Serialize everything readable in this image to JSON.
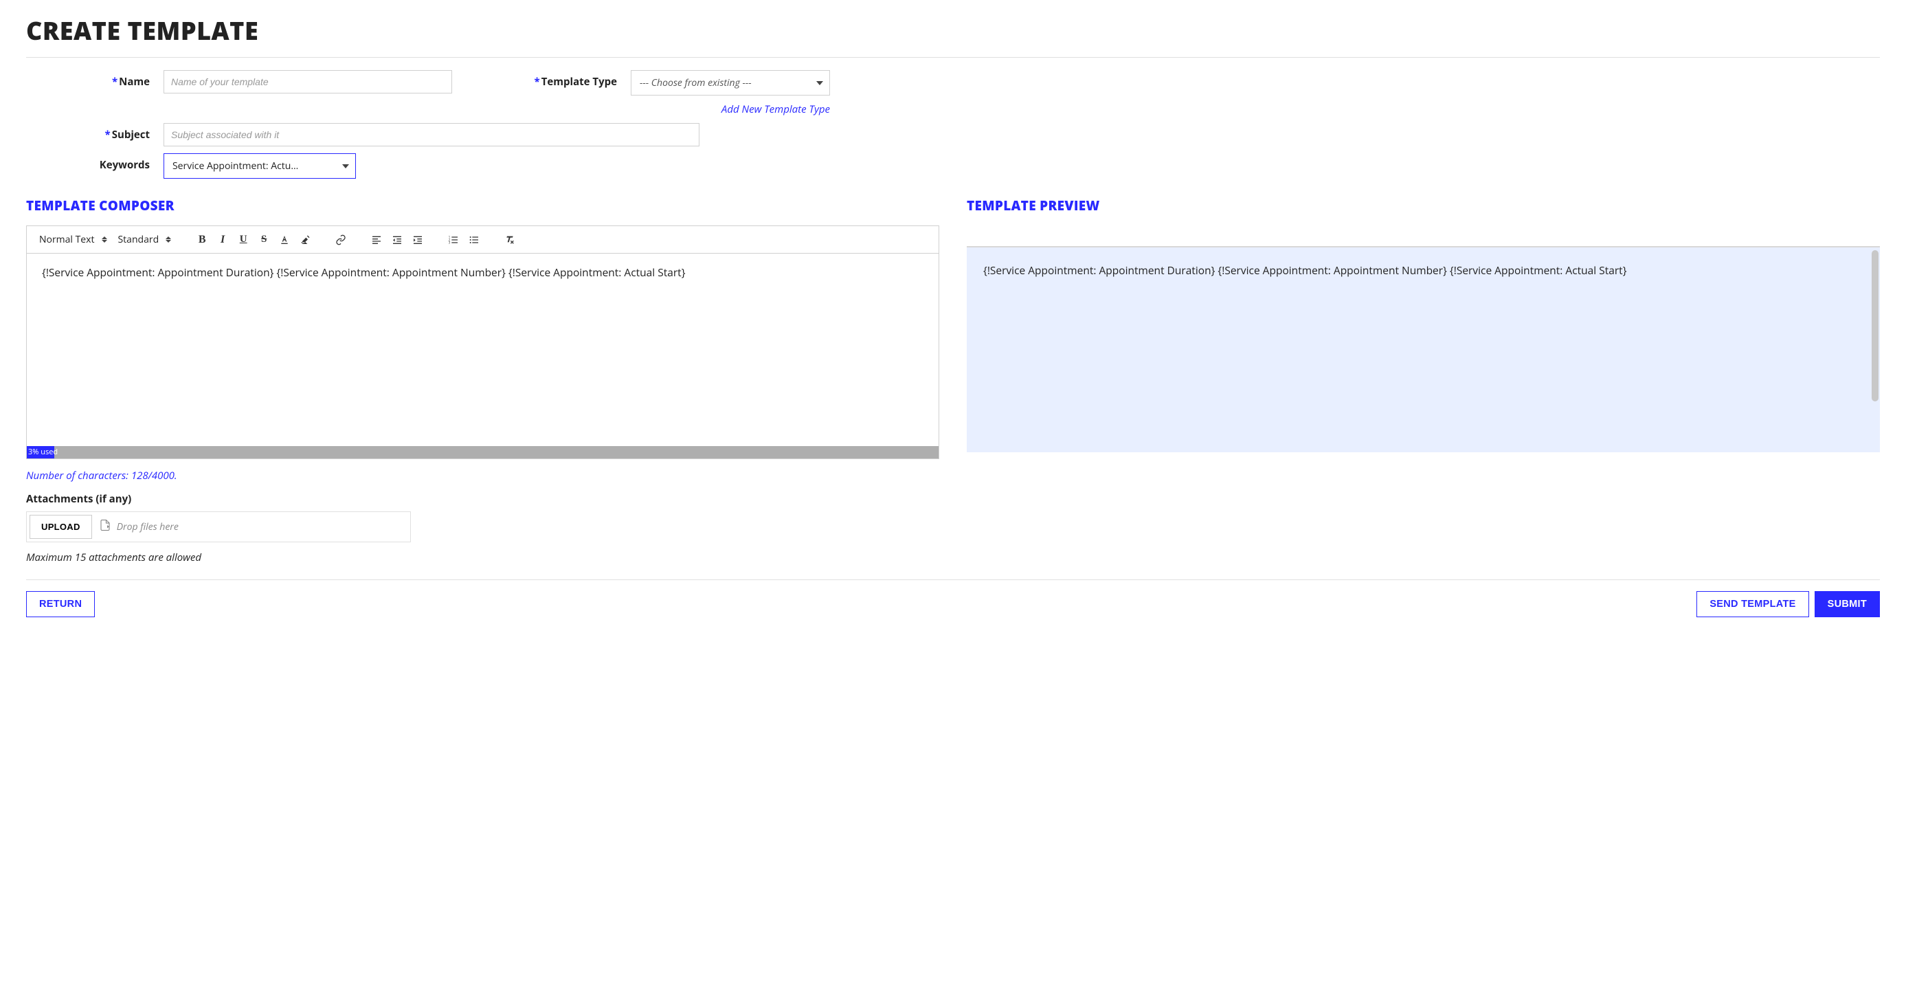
{
  "page_title": "CREATE TEMPLATE",
  "fields": {
    "name": {
      "label": "Name",
      "placeholder": "Name of your template",
      "required": true
    },
    "template_type": {
      "label": "Template Type",
      "placeholder": "--- Choose from existing ---",
      "required": true,
      "add_link": "Add New Template Type"
    },
    "subject": {
      "label": "Subject",
      "placeholder": "Subject associated with it",
      "required": true
    },
    "keywords": {
      "label": "Keywords",
      "value": "Service Appointment: Actu…",
      "required": false
    }
  },
  "composer": {
    "heading": "TEMPLATE COMPOSER",
    "block_style": "Normal Text",
    "font_weight": "Standard",
    "content": "{!Service Appointment: Appointment Duration}  {!Service Appointment: Appointment Number}  {!Service Appointment: Actual Start}",
    "usage_percent": 3,
    "usage_label": "3% used",
    "char_count_text": "Number of characters: 128/4000."
  },
  "preview": {
    "heading": "TEMPLATE PREVIEW",
    "content": "{!Service Appointment: Appointment Duration}  {!Service Appointment: Appointment Number}  {!Service Appointment: Actual Start}"
  },
  "attachments": {
    "label": "Attachments (if any)",
    "upload_button": "UPLOAD",
    "drop_hint": "Drop files here",
    "max_note": "Maximum 15 attachments are allowed"
  },
  "footer": {
    "return": "RETURN",
    "send": "SEND TEMPLATE",
    "submit": "SUBMIT"
  }
}
